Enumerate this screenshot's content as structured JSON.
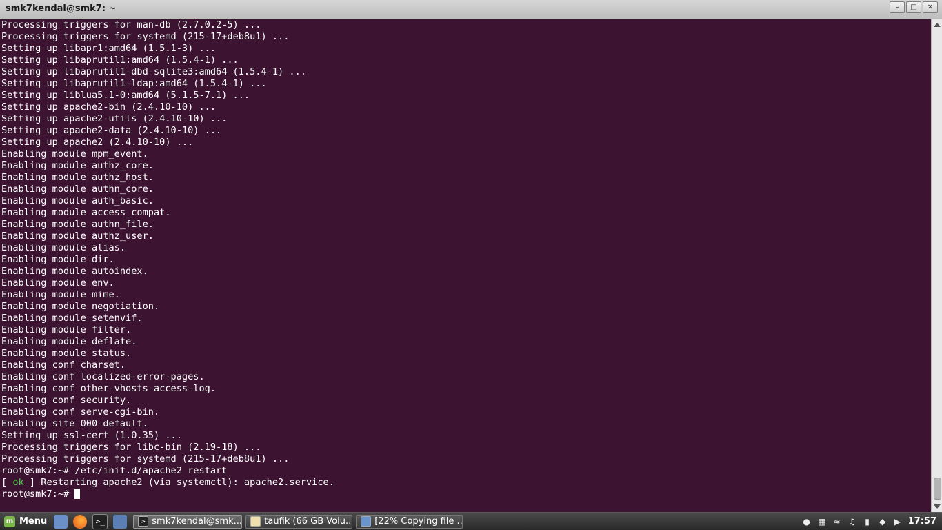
{
  "window": {
    "title": "smk7kendal@smk7: ~"
  },
  "terminal": {
    "lines": [
      "Processing triggers for man-db (2.7.0.2-5) ...",
      "Processing triggers for systemd (215-17+deb8u1) ...",
      "Setting up libapr1:amd64 (1.5.1-3) ...",
      "Setting up libaprutil1:amd64 (1.5.4-1) ...",
      "Setting up libaprutil1-dbd-sqlite3:amd64 (1.5.4-1) ...",
      "Setting up libaprutil1-ldap:amd64 (1.5.4-1) ...",
      "Setting up liblua5.1-0:amd64 (5.1.5-7.1) ...",
      "Setting up apache2-bin (2.4.10-10) ...",
      "Setting up apache2-utils (2.4.10-10) ...",
      "Setting up apache2-data (2.4.10-10) ...",
      "Setting up apache2 (2.4.10-10) ...",
      "Enabling module mpm_event.",
      "Enabling module authz_core.",
      "Enabling module authz_host.",
      "Enabling module authn_core.",
      "Enabling module auth_basic.",
      "Enabling module access_compat.",
      "Enabling module authn_file.",
      "Enabling module authz_user.",
      "Enabling module alias.",
      "Enabling module dir.",
      "Enabling module autoindex.",
      "Enabling module env.",
      "Enabling module mime.",
      "Enabling module negotiation.",
      "Enabling module setenvif.",
      "Enabling module filter.",
      "Enabling module deflate.",
      "Enabling module status.",
      "Enabling conf charset.",
      "Enabling conf localized-error-pages.",
      "Enabling conf other-vhosts-access-log.",
      "Enabling conf security.",
      "Enabling conf serve-cgi-bin.",
      "Enabling site 000-default.",
      "Setting up ssl-cert (1.0.35) ...",
      "Processing triggers for libc-bin (2.19-18) ...",
      "Processing triggers for systemd (215-17+deb8u1) ...",
      "root@smk7:~# /etc/init.d/apache2 restart"
    ],
    "status_line": {
      "open": "[ ",
      "ok": "ok",
      "rest": " ] Restarting apache2 (via systemctl): apache2.service."
    },
    "prompt": "root@smk7:~# "
  },
  "taskbar": {
    "menu_label": "Menu",
    "tasks": [
      {
        "label": "smk7kendal@smk...",
        "icon": "terminal-icon",
        "active": true
      },
      {
        "label": "taufik (66 GB Volu...",
        "icon": "text-editor-icon",
        "active": false
      },
      {
        "label": "[22% Copying file ...",
        "icon": "folder-icon",
        "active": false
      }
    ],
    "clock": "17:57"
  }
}
